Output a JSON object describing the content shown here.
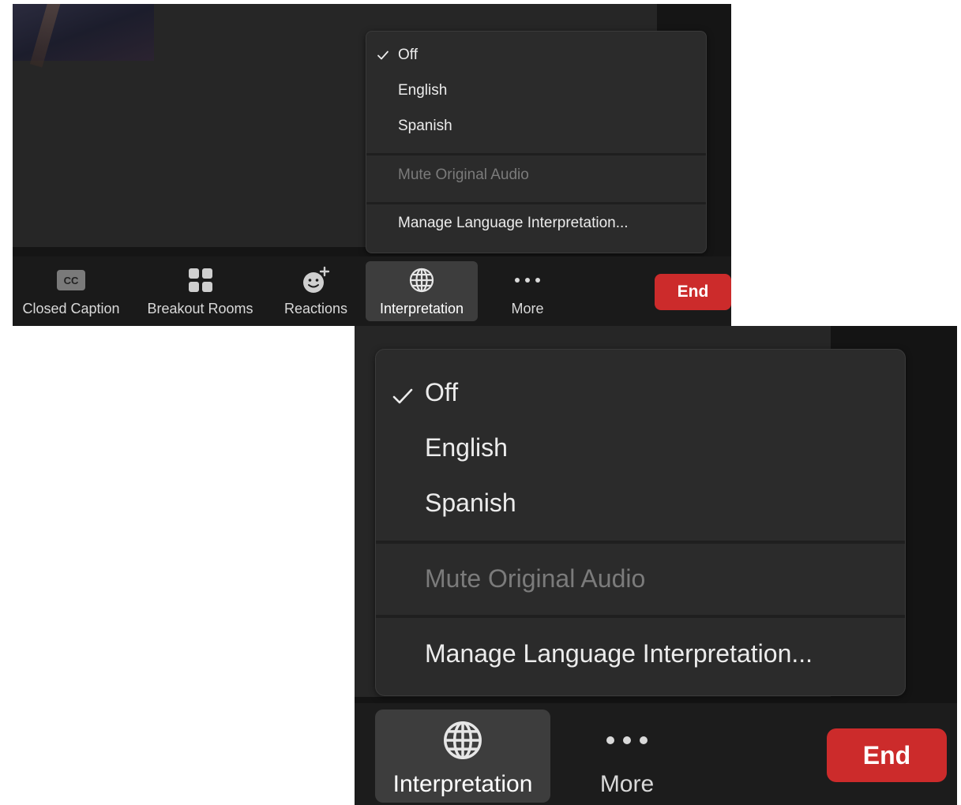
{
  "language_menu": {
    "items": [
      {
        "label": "Off",
        "checked": true
      },
      {
        "label": "English",
        "checked": false
      },
      {
        "label": "Spanish",
        "checked": false
      }
    ],
    "mute_original_audio": "Mute Original Audio",
    "manage": "Manage Language Interpretation..."
  },
  "toolbar": {
    "closed_caption": {
      "label": "Closed Caption",
      "icon_text": "CC",
      "icon": "cc-icon"
    },
    "breakout_rooms": {
      "label": "Breakout Rooms",
      "icon": "grid-icon"
    },
    "reactions": {
      "label": "Reactions",
      "icon": "emoji-plus-icon"
    },
    "interpretation": {
      "label": "Interpretation",
      "icon": "globe-icon",
      "active": true
    },
    "more": {
      "label": "More",
      "icon": "ellipsis-icon"
    },
    "end": {
      "label": "End"
    }
  },
  "colors": {
    "end_button": "#cc2b2b",
    "menu_background": "#2b2b2b",
    "toolbar_background": "#1a1a1a",
    "disabled_text": "#7b7b7b"
  }
}
